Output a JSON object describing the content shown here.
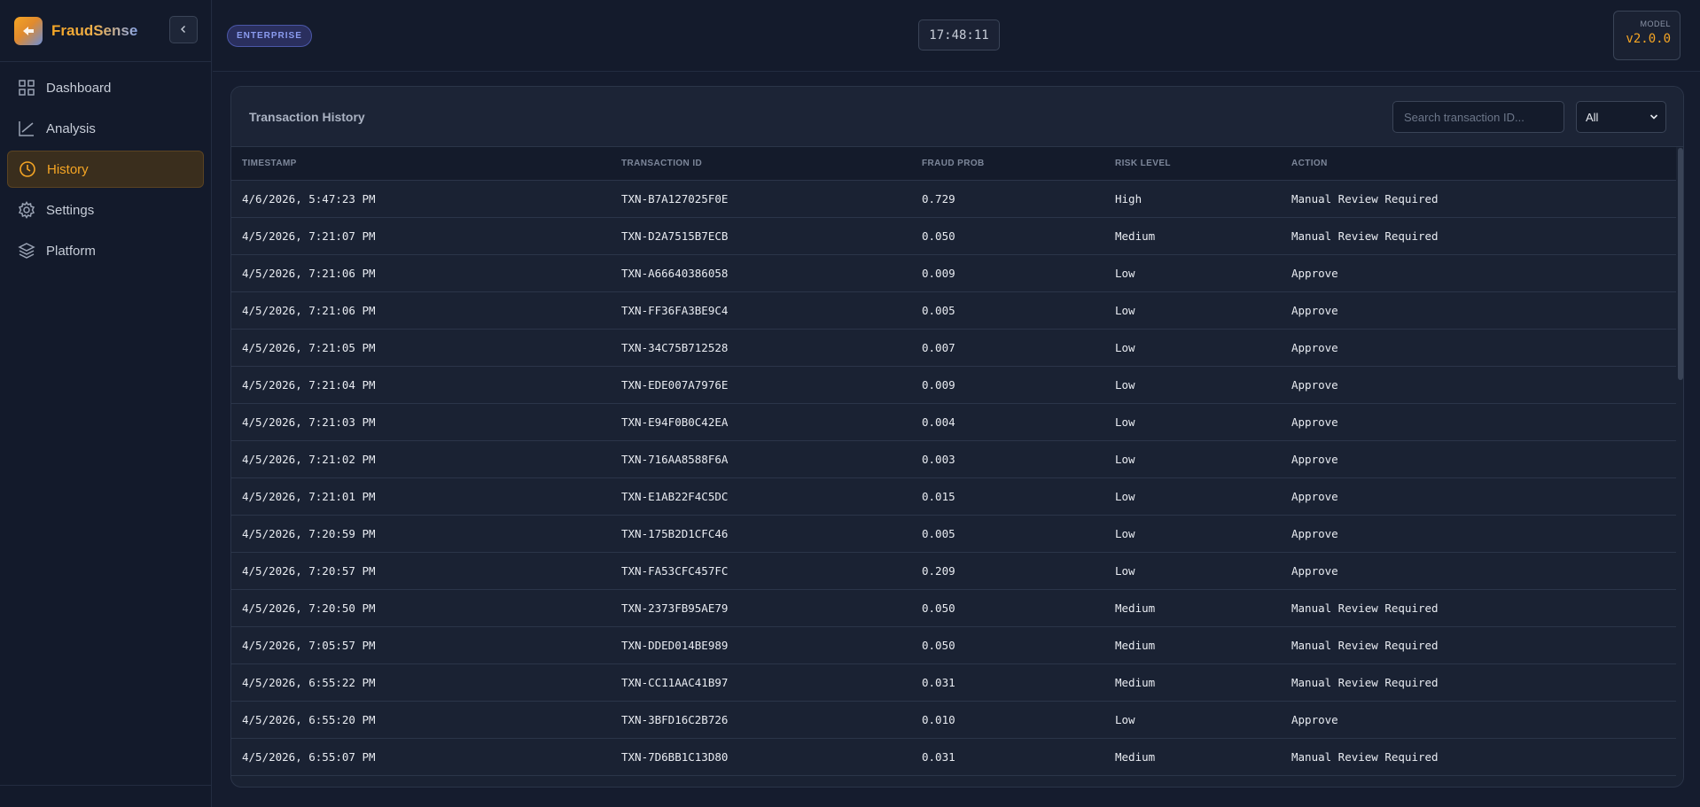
{
  "brand": {
    "name": "FraudSense"
  },
  "sidebar": {
    "items": [
      {
        "label": "Dashboard",
        "icon": "grid-icon",
        "active": false
      },
      {
        "label": "Analysis",
        "icon": "chart-line-icon",
        "active": false
      },
      {
        "label": "History",
        "icon": "clock-icon",
        "active": true
      },
      {
        "label": "Settings",
        "icon": "gear-icon",
        "active": false
      },
      {
        "label": "Platform",
        "icon": "layers-icon",
        "active": false
      }
    ]
  },
  "topbar": {
    "edition": "ENTERPRISE",
    "clock": "17:48:11",
    "model_label": "MODEL",
    "model_version": "v2.0.0"
  },
  "history": {
    "title": "Transaction History",
    "search_placeholder": "Search transaction ID...",
    "filter_value": "All",
    "columns": [
      "TIMESTAMP",
      "TRANSACTION ID",
      "FRAUD PROB",
      "RISK LEVEL",
      "ACTION"
    ],
    "rows": [
      [
        "4/6/2026, 5:47:23 PM",
        "TXN-B7A127025F0E",
        "0.729",
        "High",
        "Manual Review Required"
      ],
      [
        "4/5/2026, 7:21:07 PM",
        "TXN-D2A7515B7ECB",
        "0.050",
        "Medium",
        "Manual Review Required"
      ],
      [
        "4/5/2026, 7:21:06 PM",
        "TXN-A66640386058",
        "0.009",
        "Low",
        "Approve"
      ],
      [
        "4/5/2026, 7:21:06 PM",
        "TXN-FF36FA3BE9C4",
        "0.005",
        "Low",
        "Approve"
      ],
      [
        "4/5/2026, 7:21:05 PM",
        "TXN-34C75B712528",
        "0.007",
        "Low",
        "Approve"
      ],
      [
        "4/5/2026, 7:21:04 PM",
        "TXN-EDE007A7976E",
        "0.009",
        "Low",
        "Approve"
      ],
      [
        "4/5/2026, 7:21:03 PM",
        "TXN-E94F0B0C42EA",
        "0.004",
        "Low",
        "Approve"
      ],
      [
        "4/5/2026, 7:21:02 PM",
        "TXN-716AA8588F6A",
        "0.003",
        "Low",
        "Approve"
      ],
      [
        "4/5/2026, 7:21:01 PM",
        "TXN-E1AB22F4C5DC",
        "0.015",
        "Low",
        "Approve"
      ],
      [
        "4/5/2026, 7:20:59 PM",
        "TXN-175B2D1CFC46",
        "0.005",
        "Low",
        "Approve"
      ],
      [
        "4/5/2026, 7:20:57 PM",
        "TXN-FA53CFC457FC",
        "0.209",
        "Low",
        "Approve"
      ],
      [
        "4/5/2026, 7:20:50 PM",
        "TXN-2373FB95AE79",
        "0.050",
        "Medium",
        "Manual Review Required"
      ],
      [
        "4/5/2026, 7:05:57 PM",
        "TXN-DDED014BE989",
        "0.050",
        "Medium",
        "Manual Review Required"
      ],
      [
        "4/5/2026, 6:55:22 PM",
        "TXN-CC11AAC41B97",
        "0.031",
        "Medium",
        "Manual Review Required"
      ],
      [
        "4/5/2026, 6:55:20 PM",
        "TXN-3BFD16C2B726",
        "0.010",
        "Low",
        "Approve"
      ],
      [
        "4/5/2026, 6:55:07 PM",
        "TXN-7D6BB1C13D80",
        "0.031",
        "Medium",
        "Manual Review Required"
      ]
    ]
  },
  "colors": {
    "accent": "#f5a524",
    "edition": "#8b9cf0",
    "background": "#151c2e"
  }
}
